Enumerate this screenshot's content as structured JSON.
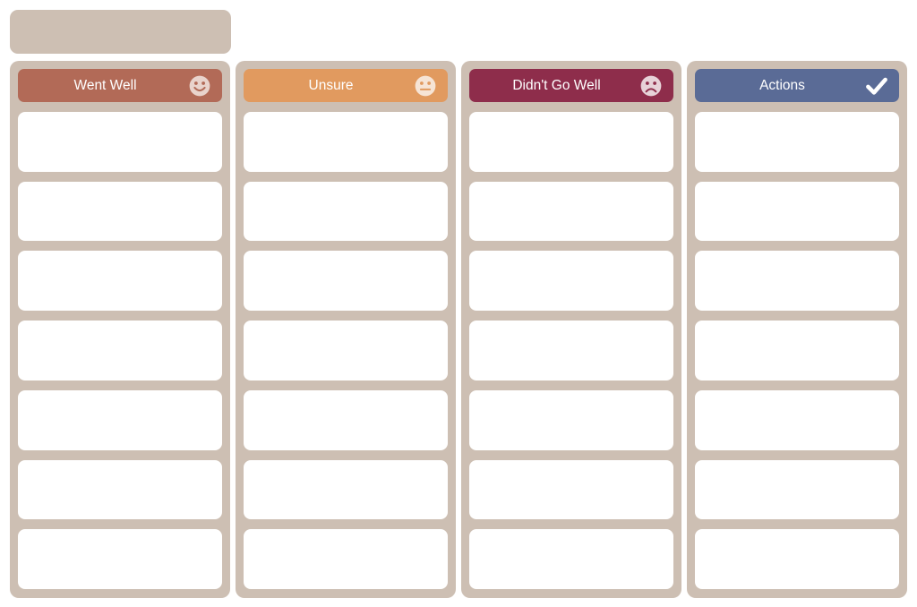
{
  "board": {
    "type": "retrospective-board",
    "title_panel": {
      "text": "",
      "color": "#cdbfb3"
    },
    "column_background": "#cdbfb3",
    "card_background": "#ffffff",
    "page_background": "#ffffff",
    "cards_per_column": 7,
    "columns": [
      {
        "id": "went-well",
        "label": "Went Well",
        "icon": "smiley-face-icon",
        "header_color": "#b26a57",
        "icon_face_color": "#e9d3cc",
        "icon_feature_color": "#b26a57",
        "cards": [
          "",
          "",
          "",
          "",
          "",
          "",
          ""
        ]
      },
      {
        "id": "unsure",
        "label": "Unsure",
        "icon": "neutral-face-icon",
        "header_color": "#e19a5f",
        "icon_face_color": "#f6e4d5",
        "icon_feature_color": "#e19a5f",
        "cards": [
          "",
          "",
          "",
          "",
          "",
          "",
          ""
        ]
      },
      {
        "id": "didnt-go-well",
        "label": "Didn't Go Well",
        "icon": "sad-face-icon",
        "header_color": "#8e2d4b",
        "icon_face_color": "#e7d2d8",
        "icon_feature_color": "#8e2d4b",
        "cards": [
          "",
          "",
          "",
          "",
          "",
          "",
          ""
        ]
      },
      {
        "id": "actions",
        "label": "Actions",
        "icon": "checkmark-icon",
        "header_color": "#5a6b96",
        "icon_face_color": "#ffffff",
        "icon_feature_color": "#ffffff",
        "cards": [
          "",
          "",
          "",
          "",
          "",
          "",
          ""
        ]
      }
    ]
  }
}
